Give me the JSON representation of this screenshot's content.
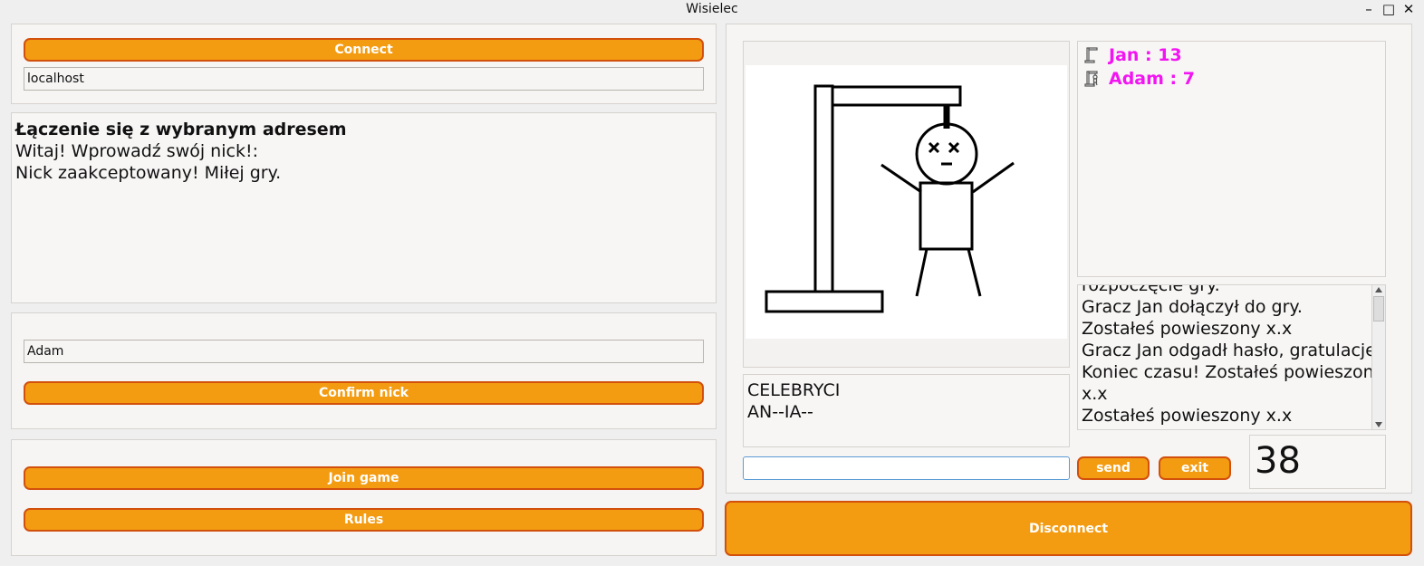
{
  "window": {
    "title": "Wisielec",
    "controls": [
      "–",
      "□",
      "✕"
    ]
  },
  "connection": {
    "connect_label": "Connect",
    "address_value": "localhost"
  },
  "server_log": {
    "lines": [
      "Łączenie się z wybranym adresem",
      "Witaj! Wprowadź swój nick!:",
      "Nick zaakceptowany! Miłej gry."
    ]
  },
  "nick": {
    "value": "Adam",
    "confirm_label": "Confirm nick"
  },
  "menu": {
    "join_label": "Join game",
    "rules_label": "Rules"
  },
  "game": {
    "category": "CELEBRYCI",
    "masked_word": "AN--IA--",
    "guess_value": "",
    "send_label": "send",
    "exit_label": "exit",
    "timer": "38"
  },
  "players": [
    {
      "text": "Jan : 13",
      "icon": "gallows-empty-icon"
    },
    {
      "text": "Adam : 7",
      "icon": "gallows-partial-icon"
    }
  ],
  "chat": {
    "lines": [
      "rozpoczęcie gry.",
      "Gracz Jan dołączył do gry.",
      "Zostałeś powieszony x.x",
      "Gracz Jan odgadł hasło, gratulacje!",
      "Koniec czasu! Zostałeś powieszony",
      "x.x",
      "Zostałeś powieszony x.x"
    ]
  },
  "disconnect_label": "Disconnect",
  "colors": {
    "button_fill": "#f39c12",
    "button_border": "#d2500c",
    "player_text": "#f215f2",
    "input_focus": "#5b9bd5"
  }
}
